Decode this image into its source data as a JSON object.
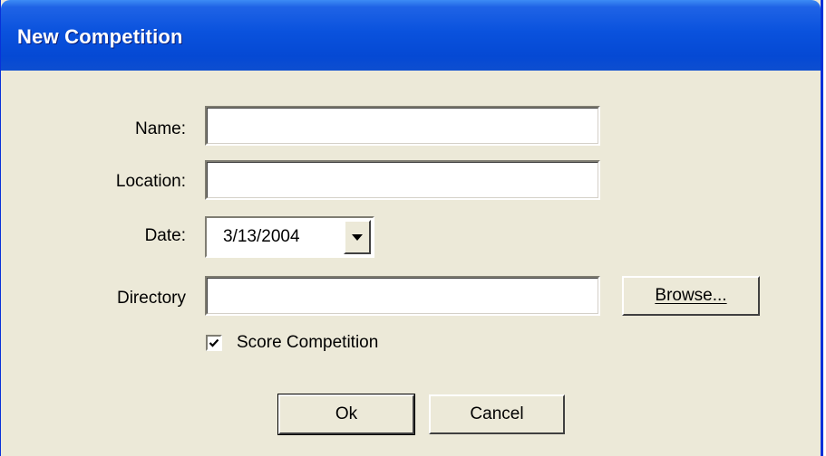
{
  "window": {
    "title": "New Competition"
  },
  "form": {
    "name_label": "Name:",
    "name_value": "",
    "location_label": "Location:",
    "location_value": "",
    "date_label": "Date:",
    "date_value": "3/13/2004",
    "directory_label": "Directory",
    "directory_value": "",
    "browse_label": "Browse...",
    "score_label": "Score Competition",
    "score_checked": true
  },
  "buttons": {
    "ok_label": "Ok",
    "cancel_label": "Cancel"
  },
  "icons": {
    "dropdown": "chevron-down-icon",
    "check": "checkmark-icon"
  },
  "colors": {
    "titlebar": "#0a52dd",
    "dialog_bg": "#ece9d8"
  }
}
